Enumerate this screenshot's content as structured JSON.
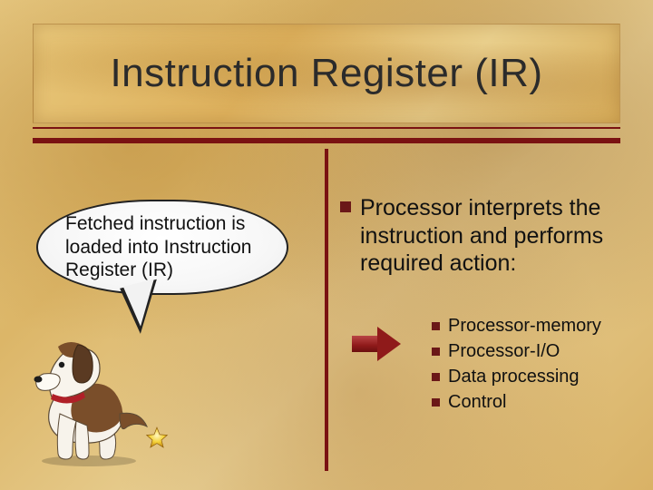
{
  "title": "Instruction Register (IR)",
  "callout": "Fetched instruction is loaded into Instruction Register (IR)",
  "mainBullet": "Processor interprets the instruction and performs required action:",
  "subBullets": [
    "Processor-memory",
    "Processor-I/O",
    "Data processing",
    "Control"
  ],
  "icons": {
    "star": "star-icon",
    "arrow": "arrow-right-icon",
    "dog": "dog-image"
  },
  "colors": {
    "accent": "#7a1212",
    "bullet": "#6b1818"
  }
}
